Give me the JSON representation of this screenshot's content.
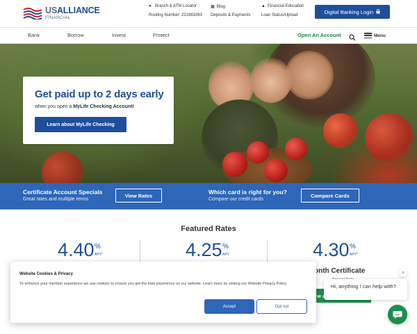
{
  "brand": {
    "name_light": "US",
    "name_bold": "ALLIANCE",
    "sub": "FINANCIAL"
  },
  "utility": {
    "branch_locator": "Branch & ATM Locator",
    "routing": "Routing Number: 221981063",
    "blog": "Blog",
    "deposits": "Deposits & Payments",
    "education": "Financial Education",
    "loan_status": "Loan Status/Upload",
    "digital_banking": "Digital Banking Login"
  },
  "nav": {
    "items": [
      "Bank",
      "Borrow",
      "Invest",
      "Protect"
    ],
    "open_account": "Open An Account",
    "menu": "Menu"
  },
  "hero": {
    "title": "Get paid up to 2 days early",
    "sub_prefix": "when you open a ",
    "sub_bold": "MyLife Checking Account!",
    "button": "Learn about MyLife Checking"
  },
  "band": {
    "left_title": "Certificate Account Specials",
    "left_sub": "Great rates and multiple terms",
    "left_button": "View Rates",
    "right_title": "Which card is right for you?",
    "right_sub": "Compare our credit cards",
    "right_button": "Compare Cards"
  },
  "rates": {
    "title": "Featured Rates",
    "items": [
      {
        "value": "4.40",
        "pct": "%",
        "apy": "APY*"
      },
      {
        "value": "4.25",
        "pct": "%",
        "apy": "APY"
      },
      {
        "value": "4.30",
        "pct": "%",
        "apy": "APY*",
        "label_partial": "onth Certificate",
        "tiny": "Special Rate",
        "button_partial": "w a"
      }
    ]
  },
  "cookie": {
    "title": "Website Cookies & Privacy",
    "text": "To enhance your member experience we use cookies to ensure you get the best experience on our website. Learn more by visiting our Website Privacy Policy.",
    "accept": "Accept",
    "optout": "Opt out"
  },
  "chat": {
    "message": "Hi, anything I can help with?",
    "close": "×"
  },
  "colors": {
    "primary": "#1f4e9c",
    "band": "#2e66b8",
    "green": "#1d8f4c"
  }
}
